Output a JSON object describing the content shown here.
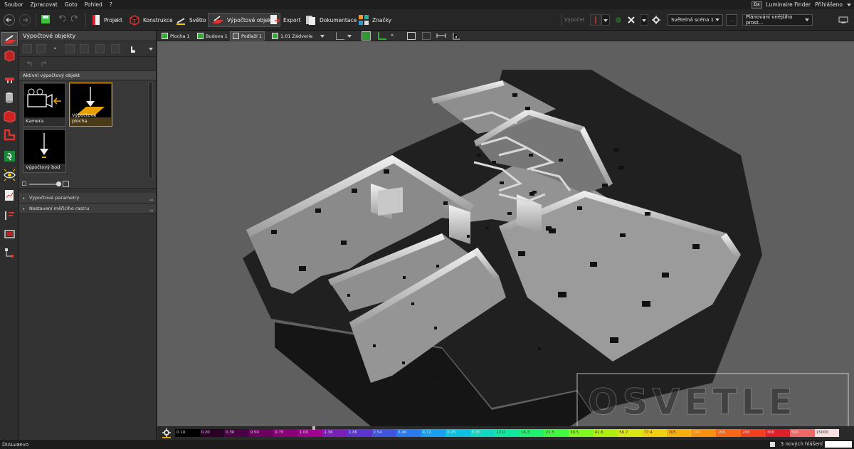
{
  "menu": {
    "items": [
      "Soubor",
      "Zpracovat",
      "Goto",
      "Pohled",
      "?"
    ]
  },
  "account": {
    "finder_badge": "Dx",
    "finder_label": "Luminaire Finder",
    "login_label": "Přihlášeno"
  },
  "toolbar": {
    "tabs": [
      "Projekt",
      "Konstrukce",
      "Světlo",
      "Výpočtové objekty",
      "Export",
      "Dokumentace",
      "Značky"
    ],
    "active_tab": "Výpočtové objekty",
    "calc_label": "Výpočet",
    "scene_select": "Světelná scéna 1",
    "scene_more": "...",
    "planning_select": "Plánování vnějšího prost..."
  },
  "panel": {
    "title": "Výpočtové objekty",
    "active_section": "Aktivní výpočtový objekt",
    "objects": [
      {
        "label": "Kamera"
      },
      {
        "label": "Výpočtová plocha",
        "selected": true
      },
      {
        "label": "Výpočtový bod"
      }
    ],
    "collapsed_sections": [
      "Výpočtové parametry",
      "Nastavení měřicího rastru"
    ]
  },
  "viewport_bar": {
    "crumbs": [
      "Plocha 1",
      "Budova 1",
      "Podlaží 1",
      "1.01 Zádverie"
    ],
    "active_crumb": "Podlaží 1"
  },
  "legend": {
    "values": [
      "0.10",
      "0.20",
      "0.30",
      "0.50",
      "0.75",
      "1.00",
      "1.36",
      "1.86",
      "2.54",
      "3.46",
      "4.72",
      "6.45",
      "8.80",
      "12.0",
      "16.3",
      "22.3",
      "30.5",
      "41.6",
      "56.7",
      "77.4",
      "105",
      "144",
      "196",
      "268",
      "366",
      "500",
      "15000"
    ],
    "colors": [
      "#000000",
      "#2a0028",
      "#4a0045",
      "#6b0060",
      "#8a0078",
      "#a10090",
      "#7a1fb8",
      "#5a35d0",
      "#3f55e0",
      "#2a7af0",
      "#1aa0f0",
      "#10c0e0",
      "#10d8c0",
      "#10e8a0",
      "#20f070",
      "#40f840",
      "#80f820",
      "#b0f010",
      "#d8e810",
      "#f0d010",
      "#f8b010",
      "#f89010",
      "#f86818",
      "#f04020",
      "#e02028",
      "#f06868",
      "#f8e0e0"
    ]
  },
  "status": {
    "brand_prefix": "DIAL",
    "brand_mid": "ux",
    "brand_suffix": "evo",
    "messages": "3 nových hlášení"
  },
  "watermark": "OSVETLE"
}
